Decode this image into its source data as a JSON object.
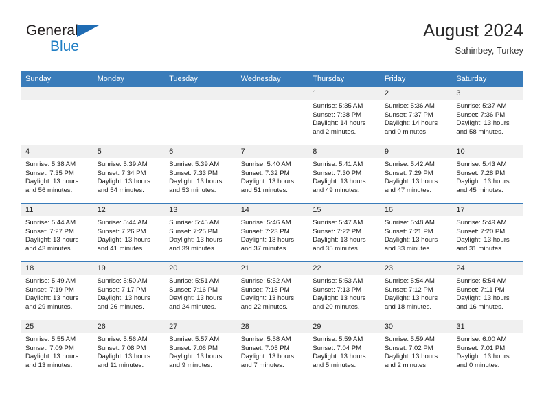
{
  "brand": {
    "line1": "General",
    "line2": "Blue",
    "triangle_color": "#1f6cb4",
    "blue_color": "#1f7ec4"
  },
  "header": {
    "title": "August 2024",
    "subtitle": "Sahinbey, Turkey"
  },
  "theme": {
    "header_bg": "#3a7cba",
    "daynum_bg": "#f0f0f0",
    "grid_line": "#3a7cba"
  },
  "weekday_headers": [
    "Sunday",
    "Monday",
    "Tuesday",
    "Wednesday",
    "Thursday",
    "Friday",
    "Saturday"
  ],
  "weeks": [
    [
      {
        "day": "",
        "blank": true,
        "sunrise": "",
        "sunset": "",
        "daylight": ""
      },
      {
        "day": "",
        "blank": true,
        "sunrise": "",
        "sunset": "",
        "daylight": ""
      },
      {
        "day": "",
        "blank": true,
        "sunrise": "",
        "sunset": "",
        "daylight": ""
      },
      {
        "day": "",
        "blank": true,
        "sunrise": "",
        "sunset": "",
        "daylight": ""
      },
      {
        "day": "1",
        "blank": false,
        "sunrise": "Sunrise: 5:35 AM",
        "sunset": "Sunset: 7:38 PM",
        "daylight": "Daylight: 14 hours and 2 minutes."
      },
      {
        "day": "2",
        "blank": false,
        "sunrise": "Sunrise: 5:36 AM",
        "sunset": "Sunset: 7:37 PM",
        "daylight": "Daylight: 14 hours and 0 minutes."
      },
      {
        "day": "3",
        "blank": false,
        "sunrise": "Sunrise: 5:37 AM",
        "sunset": "Sunset: 7:36 PM",
        "daylight": "Daylight: 13 hours and 58 minutes."
      }
    ],
    [
      {
        "day": "4",
        "blank": false,
        "sunrise": "Sunrise: 5:38 AM",
        "sunset": "Sunset: 7:35 PM",
        "daylight": "Daylight: 13 hours and 56 minutes."
      },
      {
        "day": "5",
        "blank": false,
        "sunrise": "Sunrise: 5:39 AM",
        "sunset": "Sunset: 7:34 PM",
        "daylight": "Daylight: 13 hours and 54 minutes."
      },
      {
        "day": "6",
        "blank": false,
        "sunrise": "Sunrise: 5:39 AM",
        "sunset": "Sunset: 7:33 PM",
        "daylight": "Daylight: 13 hours and 53 minutes."
      },
      {
        "day": "7",
        "blank": false,
        "sunrise": "Sunrise: 5:40 AM",
        "sunset": "Sunset: 7:32 PM",
        "daylight": "Daylight: 13 hours and 51 minutes."
      },
      {
        "day": "8",
        "blank": false,
        "sunrise": "Sunrise: 5:41 AM",
        "sunset": "Sunset: 7:30 PM",
        "daylight": "Daylight: 13 hours and 49 minutes."
      },
      {
        "day": "9",
        "blank": false,
        "sunrise": "Sunrise: 5:42 AM",
        "sunset": "Sunset: 7:29 PM",
        "daylight": "Daylight: 13 hours and 47 minutes."
      },
      {
        "day": "10",
        "blank": false,
        "sunrise": "Sunrise: 5:43 AM",
        "sunset": "Sunset: 7:28 PM",
        "daylight": "Daylight: 13 hours and 45 minutes."
      }
    ],
    [
      {
        "day": "11",
        "blank": false,
        "sunrise": "Sunrise: 5:44 AM",
        "sunset": "Sunset: 7:27 PM",
        "daylight": "Daylight: 13 hours and 43 minutes."
      },
      {
        "day": "12",
        "blank": false,
        "sunrise": "Sunrise: 5:44 AM",
        "sunset": "Sunset: 7:26 PM",
        "daylight": "Daylight: 13 hours and 41 minutes."
      },
      {
        "day": "13",
        "blank": false,
        "sunrise": "Sunrise: 5:45 AM",
        "sunset": "Sunset: 7:25 PM",
        "daylight": "Daylight: 13 hours and 39 minutes."
      },
      {
        "day": "14",
        "blank": false,
        "sunrise": "Sunrise: 5:46 AM",
        "sunset": "Sunset: 7:23 PM",
        "daylight": "Daylight: 13 hours and 37 minutes."
      },
      {
        "day": "15",
        "blank": false,
        "sunrise": "Sunrise: 5:47 AM",
        "sunset": "Sunset: 7:22 PM",
        "daylight": "Daylight: 13 hours and 35 minutes."
      },
      {
        "day": "16",
        "blank": false,
        "sunrise": "Sunrise: 5:48 AM",
        "sunset": "Sunset: 7:21 PM",
        "daylight": "Daylight: 13 hours and 33 minutes."
      },
      {
        "day": "17",
        "blank": false,
        "sunrise": "Sunrise: 5:49 AM",
        "sunset": "Sunset: 7:20 PM",
        "daylight": "Daylight: 13 hours and 31 minutes."
      }
    ],
    [
      {
        "day": "18",
        "blank": false,
        "sunrise": "Sunrise: 5:49 AM",
        "sunset": "Sunset: 7:19 PM",
        "daylight": "Daylight: 13 hours and 29 minutes."
      },
      {
        "day": "19",
        "blank": false,
        "sunrise": "Sunrise: 5:50 AM",
        "sunset": "Sunset: 7:17 PM",
        "daylight": "Daylight: 13 hours and 26 minutes."
      },
      {
        "day": "20",
        "blank": false,
        "sunrise": "Sunrise: 5:51 AM",
        "sunset": "Sunset: 7:16 PM",
        "daylight": "Daylight: 13 hours and 24 minutes."
      },
      {
        "day": "21",
        "blank": false,
        "sunrise": "Sunrise: 5:52 AM",
        "sunset": "Sunset: 7:15 PM",
        "daylight": "Daylight: 13 hours and 22 minutes."
      },
      {
        "day": "22",
        "blank": false,
        "sunrise": "Sunrise: 5:53 AM",
        "sunset": "Sunset: 7:13 PM",
        "daylight": "Daylight: 13 hours and 20 minutes."
      },
      {
        "day": "23",
        "blank": false,
        "sunrise": "Sunrise: 5:54 AM",
        "sunset": "Sunset: 7:12 PM",
        "daylight": "Daylight: 13 hours and 18 minutes."
      },
      {
        "day": "24",
        "blank": false,
        "sunrise": "Sunrise: 5:54 AM",
        "sunset": "Sunset: 7:11 PM",
        "daylight": "Daylight: 13 hours and 16 minutes."
      }
    ],
    [
      {
        "day": "25",
        "blank": false,
        "sunrise": "Sunrise: 5:55 AM",
        "sunset": "Sunset: 7:09 PM",
        "daylight": "Daylight: 13 hours and 13 minutes."
      },
      {
        "day": "26",
        "blank": false,
        "sunrise": "Sunrise: 5:56 AM",
        "sunset": "Sunset: 7:08 PM",
        "daylight": "Daylight: 13 hours and 11 minutes."
      },
      {
        "day": "27",
        "blank": false,
        "sunrise": "Sunrise: 5:57 AM",
        "sunset": "Sunset: 7:06 PM",
        "daylight": "Daylight: 13 hours and 9 minutes."
      },
      {
        "day": "28",
        "blank": false,
        "sunrise": "Sunrise: 5:58 AM",
        "sunset": "Sunset: 7:05 PM",
        "daylight": "Daylight: 13 hours and 7 minutes."
      },
      {
        "day": "29",
        "blank": false,
        "sunrise": "Sunrise: 5:59 AM",
        "sunset": "Sunset: 7:04 PM",
        "daylight": "Daylight: 13 hours and 5 minutes."
      },
      {
        "day": "30",
        "blank": false,
        "sunrise": "Sunrise: 5:59 AM",
        "sunset": "Sunset: 7:02 PM",
        "daylight": "Daylight: 13 hours and 2 minutes."
      },
      {
        "day": "31",
        "blank": false,
        "sunrise": "Sunrise: 6:00 AM",
        "sunset": "Sunset: 7:01 PM",
        "daylight": "Daylight: 13 hours and 0 minutes."
      }
    ]
  ]
}
